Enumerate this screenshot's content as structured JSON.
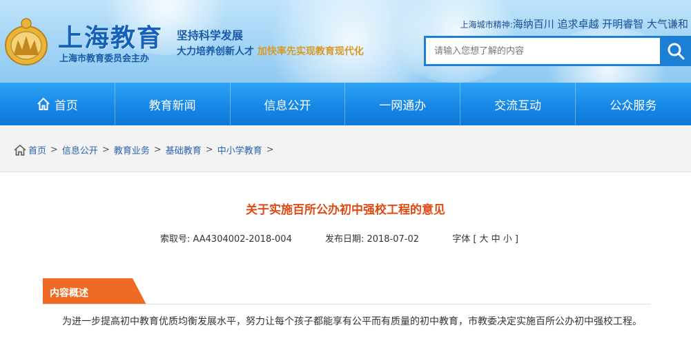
{
  "header": {
    "site_title": "上海教育",
    "site_sub": "上海市教育委员会主办",
    "slogan_line1": "坚持科学发展",
    "slogan_line2_a": "大力培养创新人才",
    "slogan_line2_b": "加快率先实现教育现代化",
    "spirit_label": "上海城市精神:",
    "spirit_text": "海纳百川 追求卓越 开明睿智 大气谦和",
    "search_placeholder": "请输入您想了解的内容"
  },
  "nav": {
    "items": [
      {
        "label": "首页"
      },
      {
        "label": "教育新闻"
      },
      {
        "label": "信息公开"
      },
      {
        "label": "一网通办"
      },
      {
        "label": "交流互动"
      },
      {
        "label": "公众服务"
      }
    ]
  },
  "breadcrumb": {
    "items": [
      "首页",
      "信息公开",
      "教育业务",
      "基础教育",
      "中小学教育"
    ],
    "separator": ">"
  },
  "article": {
    "title": "关于实施百所公办初中强校工程的意见",
    "index_label": "索取号: AA4304002-2018-004",
    "date_label": "发布日期: 2018-07-02",
    "font_label": "字体 [ 大 中 小 ]",
    "section_label": "内容概述",
    "summary": "为进一步提高初中教育优质均衡发展水平，努力让每个孩子都能享有公平而有质量的初中教育，市教委决定实施百所公办初中强校工程。"
  },
  "colors": {
    "brand_blue": "#1b7fd6",
    "title_orange": "#e04a12",
    "tab_orange": "#ef6a23"
  }
}
